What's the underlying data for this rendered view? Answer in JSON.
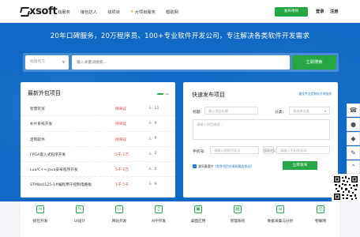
{
  "header": {
    "logo_text": "xsoft",
    "nav": [
      "找服务",
      "接包达人",
      "找项目",
      "大项目服务",
      "帮助网"
    ],
    "publish_button": "发布项目",
    "login": "登录",
    "register": "注册"
  },
  "hero": {
    "title": "20年口碑服务，20万程序员、100+专业软件开发公司，专注解决各类软件开发需求",
    "search": {
      "select_label": "找接包方",
      "placeholder": "输入关键词搜索...",
      "button": "立即搜索"
    }
  },
  "latest_projects": {
    "title": "最新外包项目",
    "rows": [
      {
        "name": "智慧农贸",
        "price": "待商议",
        "count": "11"
      },
      {
        "name": "补片系统开发",
        "price": "待商议",
        "count": "9"
      },
      {
        "name": "定制软件",
        "price": "待商议",
        "count": "9"
      },
      {
        "name": "FPGA嵌入式程序开发",
        "price": "5千-1万",
        "count": "2"
      },
      {
        "name": "Lua/C++/java安卓程序开发",
        "price": "5千-1万",
        "count": "5"
      },
      {
        "name": "STM8s0125-1#编程用于控制电路板",
        "price": "1千-5千",
        "count": "9"
      }
    ]
  },
  "quick_publish": {
    "title": "快速发布项目",
    "link": "查找专业定制化开发服务",
    "title_label": "标题:",
    "title_placeholder": "输入项目标题",
    "category_label": "分类:",
    "category_placeholder": "请选择分类",
    "description_placeholder": "请输入项目描述...",
    "phone_label": "手机号:",
    "phone_placeholder": "请输入您的手机号",
    "verify_button": "获取验证码",
    "code_placeholder": "请输入手机验证码",
    "agree_text": "我同意遵守",
    "agree_link": "《软件项目交易网服务协议》",
    "submit_button": "立即发布"
  },
  "services": [
    {
      "icon": "link-icon",
      "label": "接包开发"
    },
    {
      "icon": "ui-design-icon",
      "label": "UI设计"
    },
    {
      "icon": "website-icon",
      "label": "网站开发"
    },
    {
      "icon": "app-icon",
      "label": "APP开发"
    },
    {
      "icon": "deploy-icon",
      "label": "桌面应用"
    },
    {
      "icon": "manage-icon",
      "label": "管理系统"
    },
    {
      "icon": "data-icon",
      "label": "数据采集与分析"
    },
    {
      "icon": "iot-icon",
      "label": "物联网"
    }
  ],
  "colors": {
    "primary_blue": "#1069c4",
    "accent_green": "#27a744",
    "price_red": "#e4393c"
  }
}
